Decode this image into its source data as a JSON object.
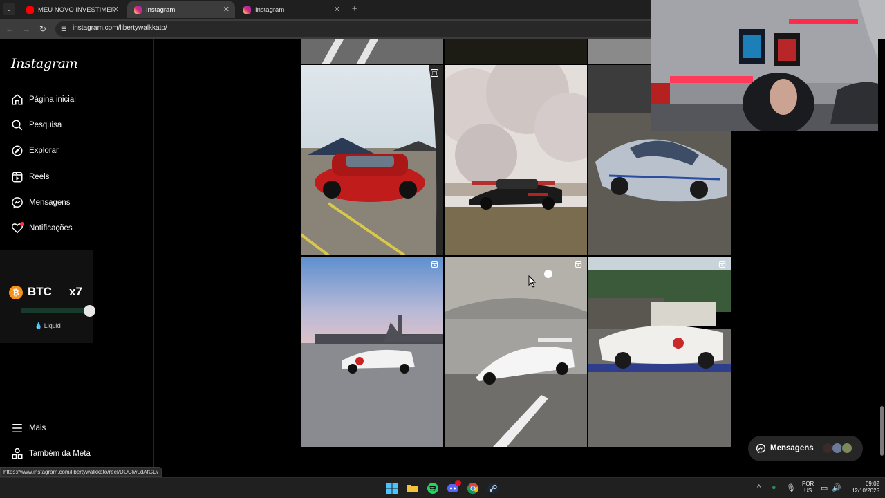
{
  "browser": {
    "tabs": [
      {
        "title": "MEU NOVO INVESTIMENTO NO",
        "favicon": "youtube-icon",
        "active": false
      },
      {
        "title": "Instagram",
        "favicon": "instagram-icon",
        "active": true
      },
      {
        "title": "Instagram",
        "favicon": "instagram-icon",
        "active": false
      }
    ],
    "url": "instagram.com/libertywalkkato/",
    "status_url": "https://www.instagram.com/libertywalkkato/reel/DOClwLdAfGD/"
  },
  "sidebar": {
    "logo": "Instagram",
    "items": [
      {
        "label": "Página inicial",
        "icon": "home-icon"
      },
      {
        "label": "Pesquisa",
        "icon": "search-icon"
      },
      {
        "label": "Explorar",
        "icon": "compass-icon"
      },
      {
        "label": "Reels",
        "icon": "reels-icon"
      },
      {
        "label": "Mensagens",
        "icon": "messenger-icon"
      },
      {
        "label": "Notificações",
        "icon": "heart-icon"
      }
    ],
    "bottom_items": [
      {
        "label": "Mais",
        "icon": "menu-icon"
      },
      {
        "label": "Também da Meta",
        "icon": "meta-apps-icon"
      }
    ]
  },
  "btc_widget": {
    "asset": "BTC",
    "multiplier": "x7",
    "footer": "Liquid",
    "slider_level": 0.95
  },
  "grid": {
    "posts": [
      {
        "type": "carousel",
        "badge": "carousel-icon"
      },
      {
        "type": "image",
        "badge": ""
      },
      {
        "type": "image",
        "badge": ""
      },
      {
        "type": "reel",
        "badge": "reel-icon"
      },
      {
        "type": "reel",
        "badge": "reel-icon"
      },
      {
        "type": "reel",
        "badge": "reel-icon"
      }
    ]
  },
  "messages_pill": {
    "label": "Mensagens"
  },
  "taskbar": {
    "apps": [
      "windows-start-icon",
      "file-explorer-icon",
      "spotify-icon",
      "discord-icon",
      "chrome-icon",
      "steam-icon"
    ],
    "discord_badge": "1",
    "lang_line1": "POR",
    "lang_line2": "US",
    "time": "09:02",
    "date": "12/10/2025"
  },
  "colors": {
    "accent_red": "#ff3040",
    "btc_orange": "#f7931a",
    "browser_dark": "#1f1f1f"
  }
}
